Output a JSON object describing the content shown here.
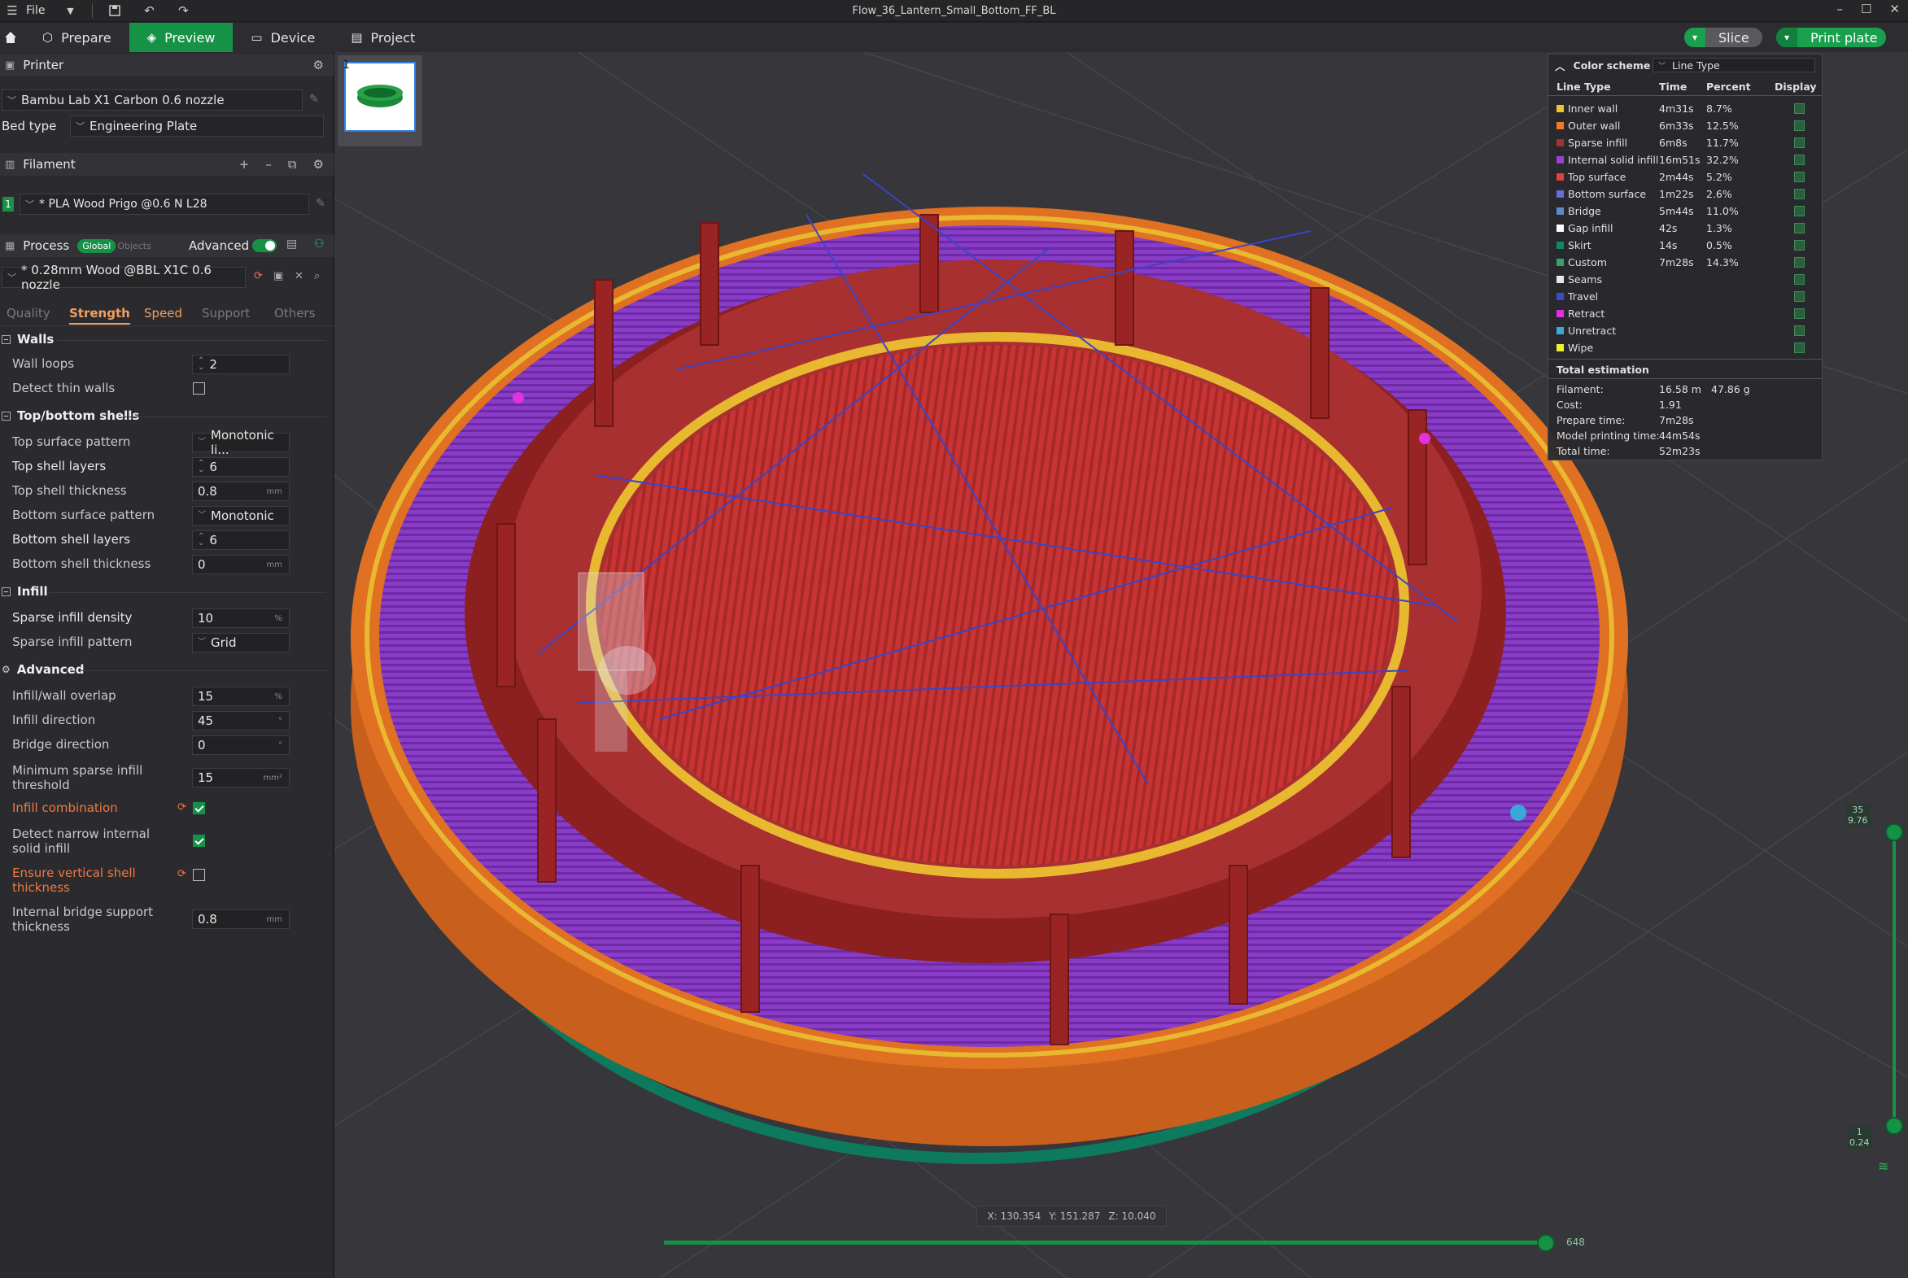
{
  "titlebar": {
    "file_label": "File",
    "title": "Flow_36_Lantern_Small_Bottom_FF_BL"
  },
  "toolbar": {
    "tabs": [
      {
        "label": "Prepare",
        "icon": "cube-icon"
      },
      {
        "label": "Preview",
        "icon": "layers-icon"
      },
      {
        "label": "Device",
        "icon": "monitor-icon"
      },
      {
        "label": "Project",
        "icon": "document-icon"
      }
    ],
    "slice_label": "Slice",
    "print_label": "Print plate"
  },
  "printer": {
    "header": "Printer",
    "name": "Bambu Lab X1 Carbon 0.6 nozzle",
    "bed_type_label": "Bed type",
    "bed_type": "Engineering Plate"
  },
  "filament": {
    "header": "Filament",
    "index": "1",
    "name": "* PLA Wood Prigo @0.6 N L28"
  },
  "process": {
    "header": "Process",
    "global_label": "Global",
    "objects_label": "Objects",
    "advanced_label": "Advanced",
    "preset": "* 0.28mm Wood @BBL X1C 0.6 nozzle",
    "tabs": [
      "Quality",
      "Strength",
      "Speed",
      "Support",
      "Others"
    ]
  },
  "groups": {
    "walls": "Walls",
    "shells": "Top/bottom shells",
    "infill": "Infill",
    "advanced": "Advanced"
  },
  "options": {
    "wall_loops": {
      "label": "Wall loops",
      "value": "2"
    },
    "detect_thin": {
      "label": "Detect thin walls"
    },
    "top_pattern": {
      "label": "Top surface pattern",
      "value": "Monotonic li..."
    },
    "top_layers": {
      "label": "Top shell layers",
      "value": "6"
    },
    "top_thickness": {
      "label": "Top shell thickness",
      "value": "0.8",
      "unit": "mm"
    },
    "bottom_pattern": {
      "label": "Bottom surface pattern",
      "value": "Monotonic"
    },
    "bottom_layers": {
      "label": "Bottom shell layers",
      "value": "6"
    },
    "bottom_thickness": {
      "label": "Bottom shell thickness",
      "value": "0",
      "unit": "mm"
    },
    "infill_density": {
      "label": "Sparse infill density",
      "value": "10",
      "unit": "%"
    },
    "infill_pattern": {
      "label": "Sparse infill pattern",
      "value": "Grid"
    },
    "overlap": {
      "label": "Infill/wall overlap",
      "value": "15",
      "unit": "%"
    },
    "infill_dir": {
      "label": "Infill direction",
      "value": "45",
      "unit": "°"
    },
    "bridge_dir": {
      "label": "Bridge direction",
      "value": "0",
      "unit": "°"
    },
    "min_sparse": {
      "label": "Minimum sparse infill threshold",
      "value": "15",
      "unit": "mm²"
    },
    "infill_comb": {
      "label": "Infill combination"
    },
    "narrow_solid": {
      "label": "Detect narrow internal solid infill"
    },
    "vertical_shell": {
      "label": "Ensure vertical shell thickness"
    },
    "bridge_support": {
      "label": "Internal bridge support thickness",
      "value": "0.8",
      "unit": "mm"
    }
  },
  "plate_thumb": {
    "index": "1"
  },
  "legend": {
    "title": "Color scheme",
    "scheme": "Line Type",
    "col_type": "Line Type",
    "col_time": "Time",
    "col_percent": "Percent",
    "col_display": "Display",
    "rows": [
      {
        "name": "Inner wall",
        "time": "4m31s",
        "percent": "8.7%",
        "color": "#f5c12a"
      },
      {
        "name": "Outer wall",
        "time": "6m33s",
        "percent": "12.5%",
        "color": "#f07b22"
      },
      {
        "name": "Sparse infill",
        "time": "6m8s",
        "percent": "11.7%",
        "color": "#a23232"
      },
      {
        "name": "Internal solid infill",
        "time": "16m51s",
        "percent": "32.2%",
        "color": "#9c3fd2"
      },
      {
        "name": "Top surface",
        "time": "2m44s",
        "percent": "5.2%",
        "color": "#e04040"
      },
      {
        "name": "Bottom surface",
        "time": "1m22s",
        "percent": "2.6%",
        "color": "#6a6ad8"
      },
      {
        "name": "Bridge",
        "time": "5m44s",
        "percent": "11.0%",
        "color": "#5b8ac8"
      },
      {
        "name": "Gap infill",
        "time": "42s",
        "percent": "1.3%",
        "color": "#ffffff"
      },
      {
        "name": "Skirt",
        "time": "14s",
        "percent": "0.5%",
        "color": "#0b8a6a"
      },
      {
        "name": "Custom",
        "time": "7m28s",
        "percent": "14.3%",
        "color": "#35a36a"
      },
      {
        "name": "Seams",
        "time": "",
        "percent": "",
        "color": "#e8e8e8"
      },
      {
        "name": "Travel",
        "time": "",
        "percent": "",
        "color": "#3a4ad0"
      },
      {
        "name": "Retract",
        "time": "",
        "percent": "",
        "color": "#e032e0"
      },
      {
        "name": "Unretract",
        "time": "",
        "percent": "",
        "color": "#3aa8d8"
      },
      {
        "name": "Wipe",
        "time": "",
        "percent": "",
        "color": "#f0f032"
      }
    ],
    "total_title": "Total estimation",
    "estimates": [
      {
        "label": "Filament:",
        "value": "16.58 m",
        "extra": "47.86 g"
      },
      {
        "label": "Cost:",
        "value": "1.91",
        "extra": ""
      },
      {
        "label": "Prepare time:",
        "value": "7m28s",
        "extra": ""
      },
      {
        "label": "Model printing time:",
        "value": "44m54s",
        "extra": ""
      },
      {
        "label": "Total time:",
        "value": "52m23s",
        "extra": ""
      }
    ]
  },
  "layer_slider": {
    "top_layer": "35",
    "top_height": "9.76",
    "bottom_layer": "1",
    "bottom_height": "0.24"
  },
  "move_slider": {
    "value": "648"
  },
  "coords": {
    "x": "X: 130.354",
    "y": "Y: 151.287",
    "z": "Z: 10.040"
  }
}
